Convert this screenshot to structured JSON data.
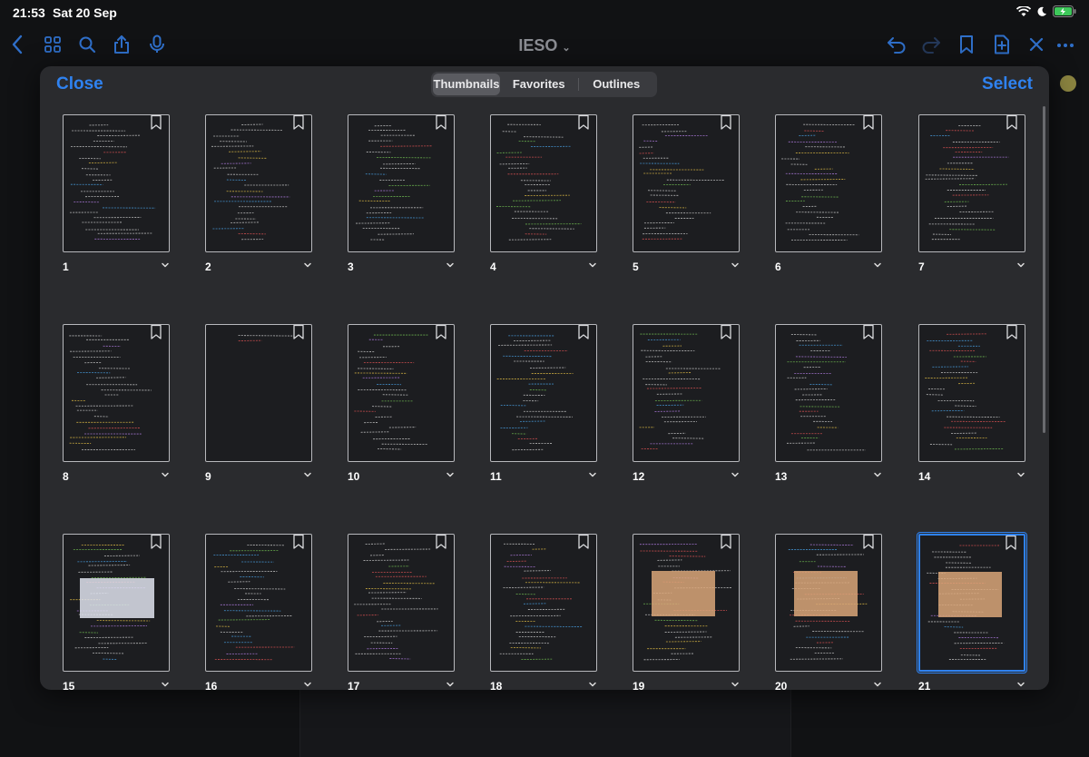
{
  "status_bar": {
    "time": "21:53",
    "date": "Sat 20 Sep",
    "icons": [
      "wifi-icon",
      "moon-icon",
      "battery-charging-icon"
    ]
  },
  "toolbar": {
    "title": "IESO",
    "left_icons": [
      "back-icon",
      "grid-icon",
      "search-icon",
      "share-icon",
      "microphone-icon"
    ],
    "right_icons": [
      "undo-icon",
      "redo-icon",
      "bookmark-icon",
      "add-page-icon",
      "close-x-icon"
    ]
  },
  "modal": {
    "close_label": "Close",
    "select_label": "Select",
    "tabs": [
      {
        "label": "Thumbnails",
        "active": true
      },
      {
        "label": "Favorites",
        "active": false
      },
      {
        "label": "Outlines",
        "active": false
      }
    ]
  },
  "pages": [
    {
      "number": "1"
    },
    {
      "number": "2"
    },
    {
      "number": "3"
    },
    {
      "number": "4"
    },
    {
      "number": "5"
    },
    {
      "number": "6"
    },
    {
      "number": "7"
    },
    {
      "number": "8"
    },
    {
      "number": "9"
    },
    {
      "number": "10"
    },
    {
      "number": "11"
    },
    {
      "number": "12"
    },
    {
      "number": "13"
    },
    {
      "number": "14"
    },
    {
      "number": "15"
    },
    {
      "number": "16"
    },
    {
      "number": "17"
    },
    {
      "number": "18"
    },
    {
      "number": "19"
    },
    {
      "number": "20"
    },
    {
      "number": "21",
      "selected": true
    }
  ],
  "colors": {
    "accent": "#2f82f0",
    "modal_bg": "#2a2b2e",
    "thumb_border": "#b7b8bc",
    "toolbar_icon": "#2f6fc9"
  }
}
